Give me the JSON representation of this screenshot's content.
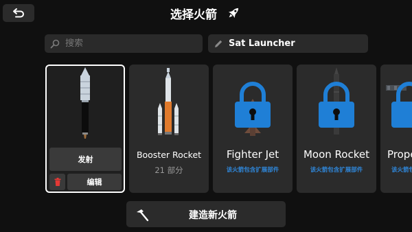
{
  "header": {
    "back_icon": "back-arrow-icon",
    "title": "选择火箭",
    "title_icon": "rocket-icon"
  },
  "search": {
    "placeholder": "搜索",
    "value": "",
    "icon": "search-icon"
  },
  "rocket_name": {
    "value": "Sat Launcher",
    "icon": "pencil-icon"
  },
  "cards": [
    {
      "name": "",
      "launch_label": "发射",
      "edit_label": "编辑",
      "delete_icon": "trash-icon",
      "selected": true
    },
    {
      "name": "Booster Rocket",
      "subtitle": "21 部分"
    },
    {
      "name": "Fighter Jet",
      "subtitle": "该火箭包含扩展部件",
      "locked": true
    },
    {
      "name": "Moon Rocket",
      "subtitle": "该火箭包含扩展部件",
      "locked": true
    },
    {
      "name": "Prope",
      "subtitle": "该火箭包含扩",
      "locked": true
    }
  ],
  "build": {
    "label": "建造新火箭",
    "icon": "hammer-icon"
  },
  "colors": {
    "background": "#101010",
    "card": "#2b2b2b",
    "button": "#3a3a3a",
    "accent_blue": "#1f7fd6",
    "delete_red": "#e53935"
  }
}
